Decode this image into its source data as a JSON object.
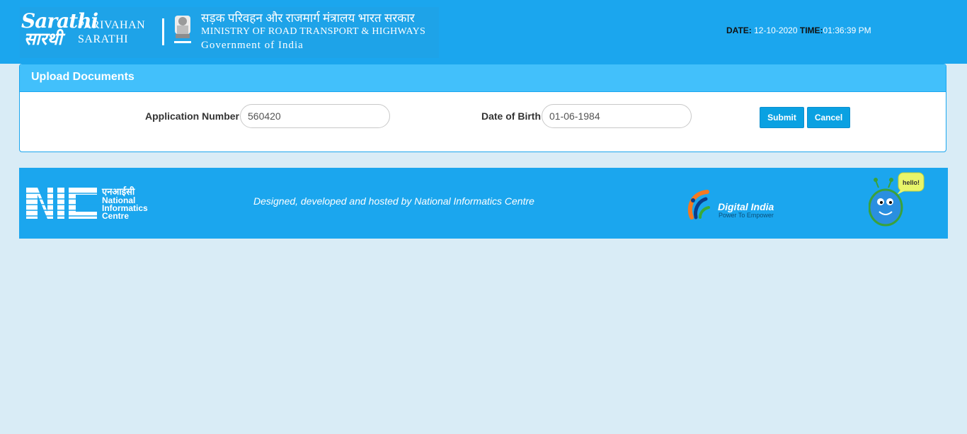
{
  "header": {
    "logo_sarathi_en": "Sarathi",
    "logo_sarathi_hi": "सारथी",
    "brand_line1": "PARIVAHAN",
    "brand_line2": "SARATHI",
    "ministry_hi": "सड़क परिवहन और राजमार्ग मंत्रालय भारत सरकार",
    "ministry_en": "MINISTRY OF ROAD TRANSPORT & HIGHWAYS",
    "government": "Government of India",
    "date_label": "DATE:",
    "date_value": "12-10-2020",
    "time_label": "TIME:",
    "time_value": "01:36:39 PM"
  },
  "panel": {
    "title": "Upload Documents",
    "application_number_label": "Application Number",
    "application_number_value": "560420",
    "dob_label": "Date of Birth",
    "dob_value": "01-06-1984",
    "submit_label": "Submit",
    "cancel_label": "Cancel"
  },
  "footer": {
    "nic_hindi": "एनआईसी",
    "nic_line1": "National",
    "nic_line2": "Informatics",
    "nic_line3": "Centre",
    "credit": "Designed, developed and hosted by National Informatics Centre",
    "digital_india": "Digital India",
    "digital_india_tagline": "Power To Empower",
    "bot_speech": "hello!"
  },
  "colors": {
    "header_blue": "#1ba6ee",
    "panel_head": "#42c0fb",
    "button": "#0aa1e2",
    "page_bg": "#d9ecf6"
  }
}
